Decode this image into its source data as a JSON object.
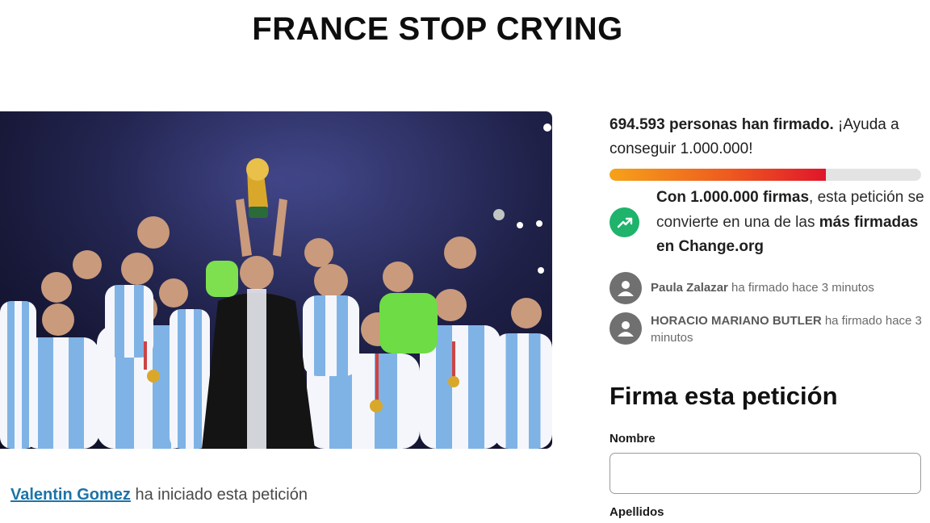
{
  "petition": {
    "title": "FRANCE STOP CRYING",
    "starter_name": "Valentin Gomez",
    "starter_suffix": " ha iniciado esta petición"
  },
  "signatures": {
    "count_text": "694.593 personas han firmado.",
    "help_text": " ¡Ayuda a conseguir 1.000.000!",
    "progress_fraction": 0.6946,
    "goal_bold": "Con 1.000.000 firmas",
    "goal_mid": ", esta petición se convierte en una de las ",
    "goal_bold2": "más firmadas en Change.org",
    "recent": [
      {
        "name": "Paula Zalazar",
        "text": " ha firmado hace 3 minutos"
      },
      {
        "name": "HORACIO MARIANO BUTLER",
        "text": " ha firmado hace 3 minutos"
      }
    ]
  },
  "form": {
    "title": "Firma esta petición",
    "first_name_label": "Nombre",
    "first_name_value": "",
    "last_name_label": "Apellidos"
  },
  "colors": {
    "progress_start": "#f6a21a",
    "progress_end": "#e0162b",
    "goal_icon": "#1fb36b",
    "link": "#1d73a8"
  },
  "icons": {
    "goal": "trending-up-icon",
    "avatar": "user-icon"
  }
}
